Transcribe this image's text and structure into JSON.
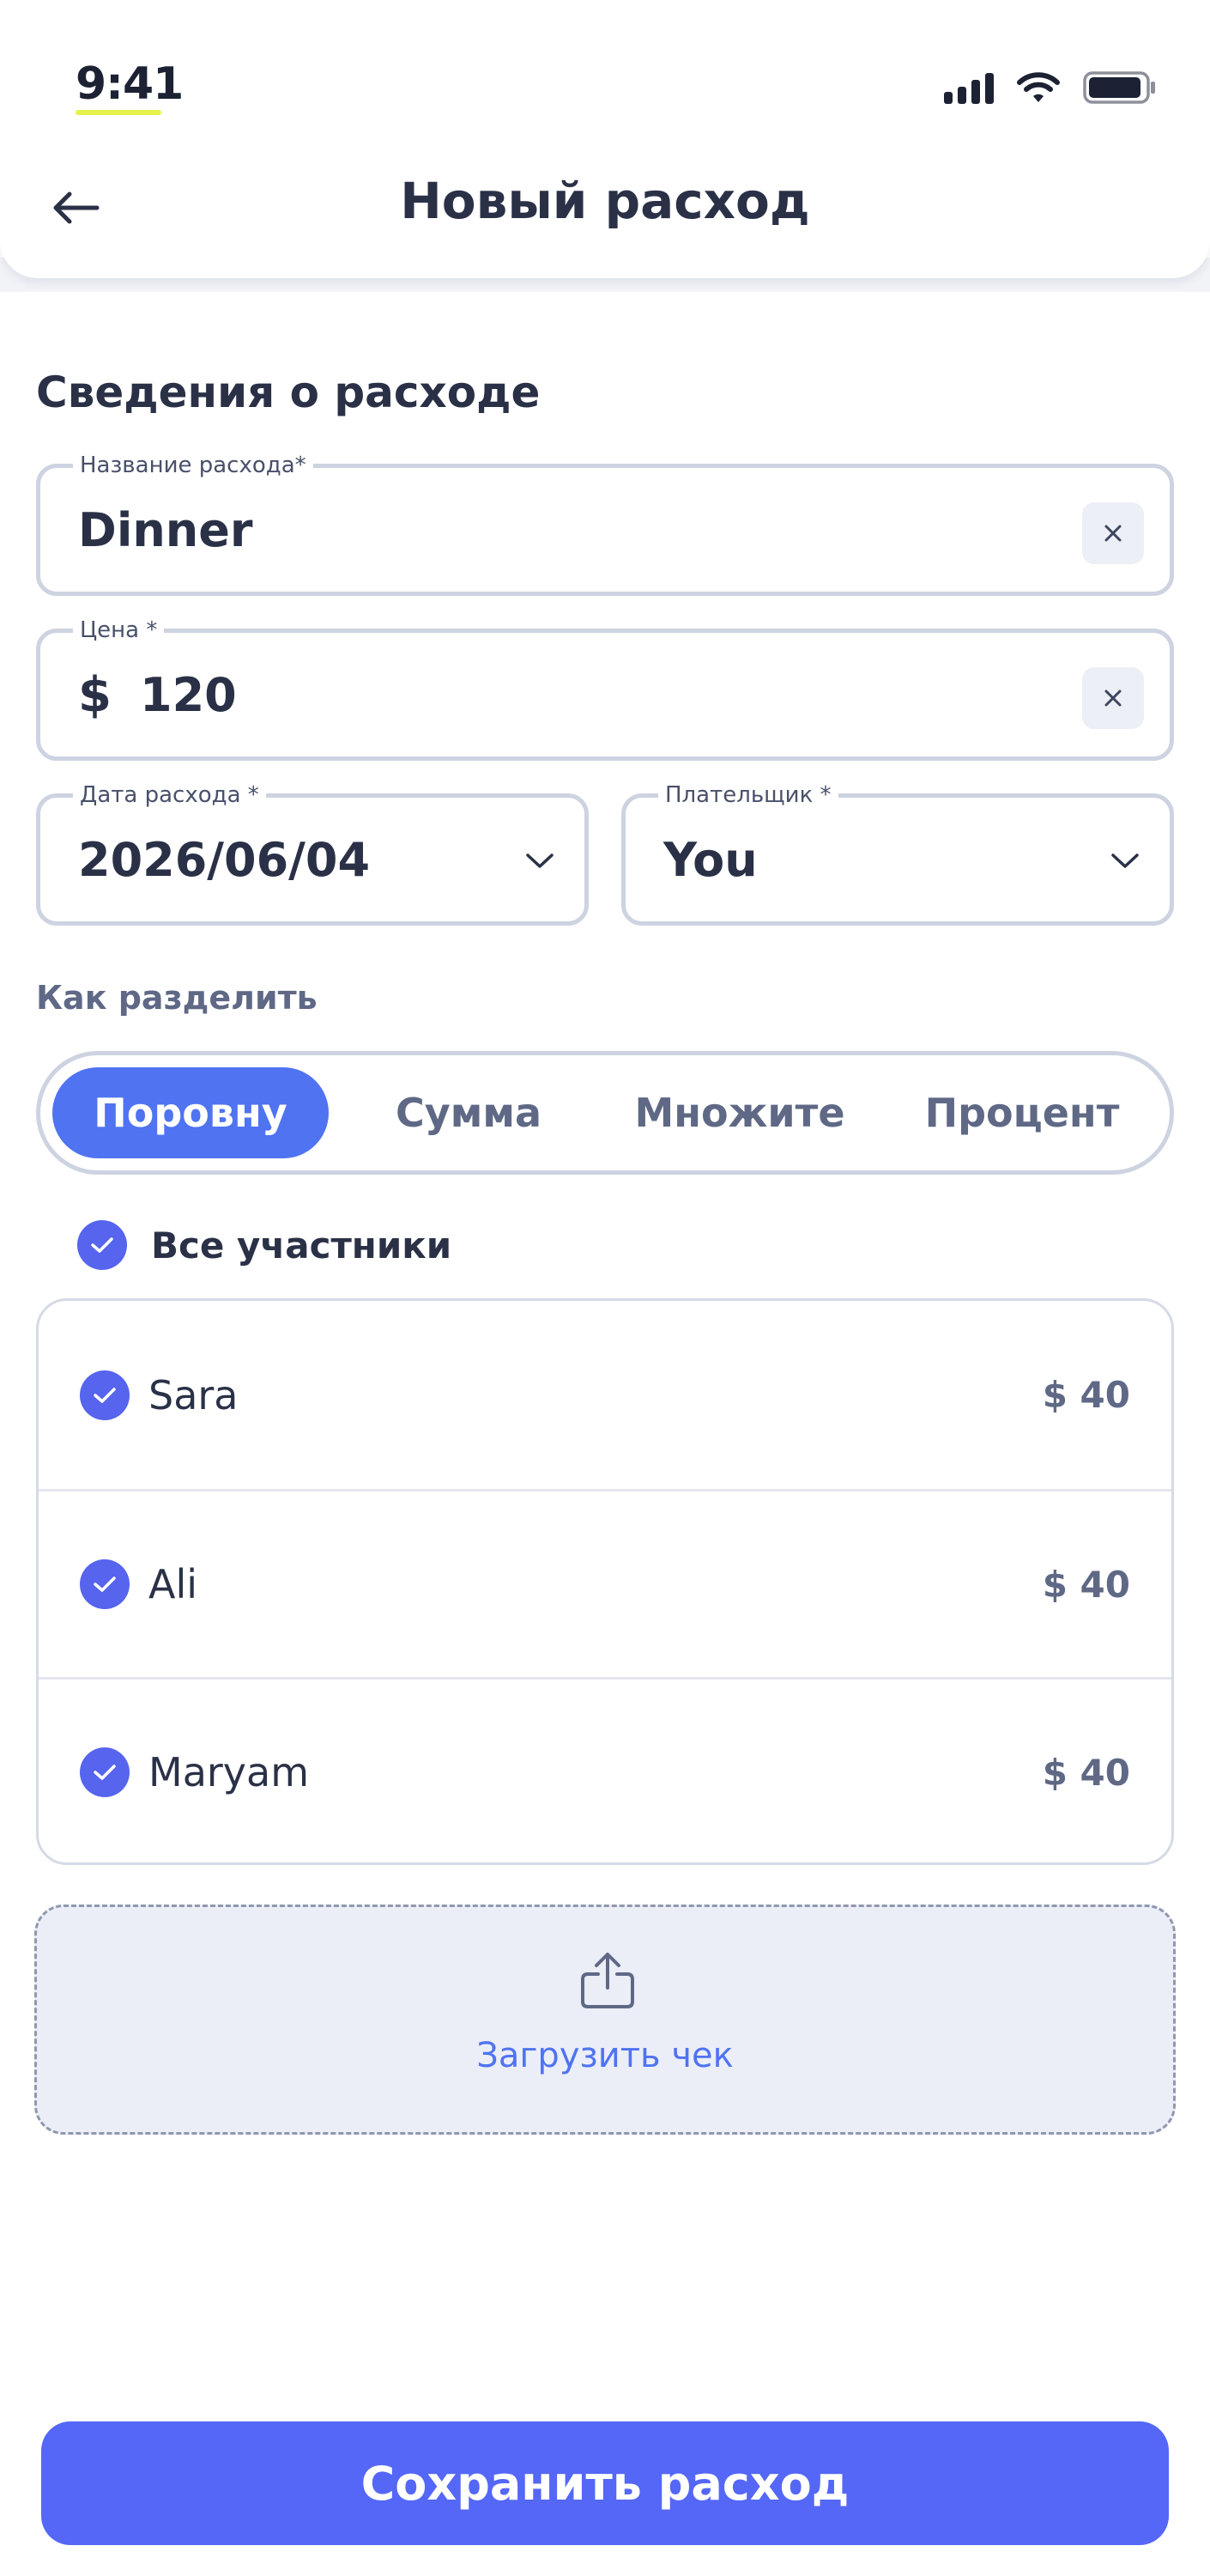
{
  "status_bar": {
    "time": "9:41"
  },
  "header": {
    "title": "Новый расход"
  },
  "section": {
    "title": "Сведения о расходе"
  },
  "fields": {
    "name": {
      "label": "Название расхода*",
      "value": "Dinner"
    },
    "price": {
      "label": "Цена *",
      "currency": "$",
      "value": "120"
    },
    "date": {
      "label": "Дата расхода *",
      "value": "2026/06/04"
    },
    "payer": {
      "label": "Плательщик *",
      "value": "You"
    }
  },
  "split": {
    "label": "Как разделить",
    "options": [
      "Поровну",
      "Сумма",
      "Множите",
      "Процент"
    ],
    "selected": "Поровну"
  },
  "participants": {
    "all_label": "Все участники",
    "all_checked": true,
    "items": [
      {
        "name": "Sara",
        "amount": "$ 40",
        "checked": true
      },
      {
        "name": "Ali",
        "amount": "$ 40",
        "checked": true
      },
      {
        "name": "Maryam",
        "amount": "$ 40",
        "checked": true
      }
    ]
  },
  "upload": {
    "label": "Загрузить чек",
    "icon": "share-upload-icon"
  },
  "actions": {
    "save_label": "Сохранить расход"
  },
  "colors": {
    "accent": "#4f73f1",
    "save_button": "#5467f7",
    "checkbox": "#5664ee",
    "text_primary": "#2a3147",
    "text_secondary": "#5f6986",
    "border": "#cdd3e0"
  }
}
